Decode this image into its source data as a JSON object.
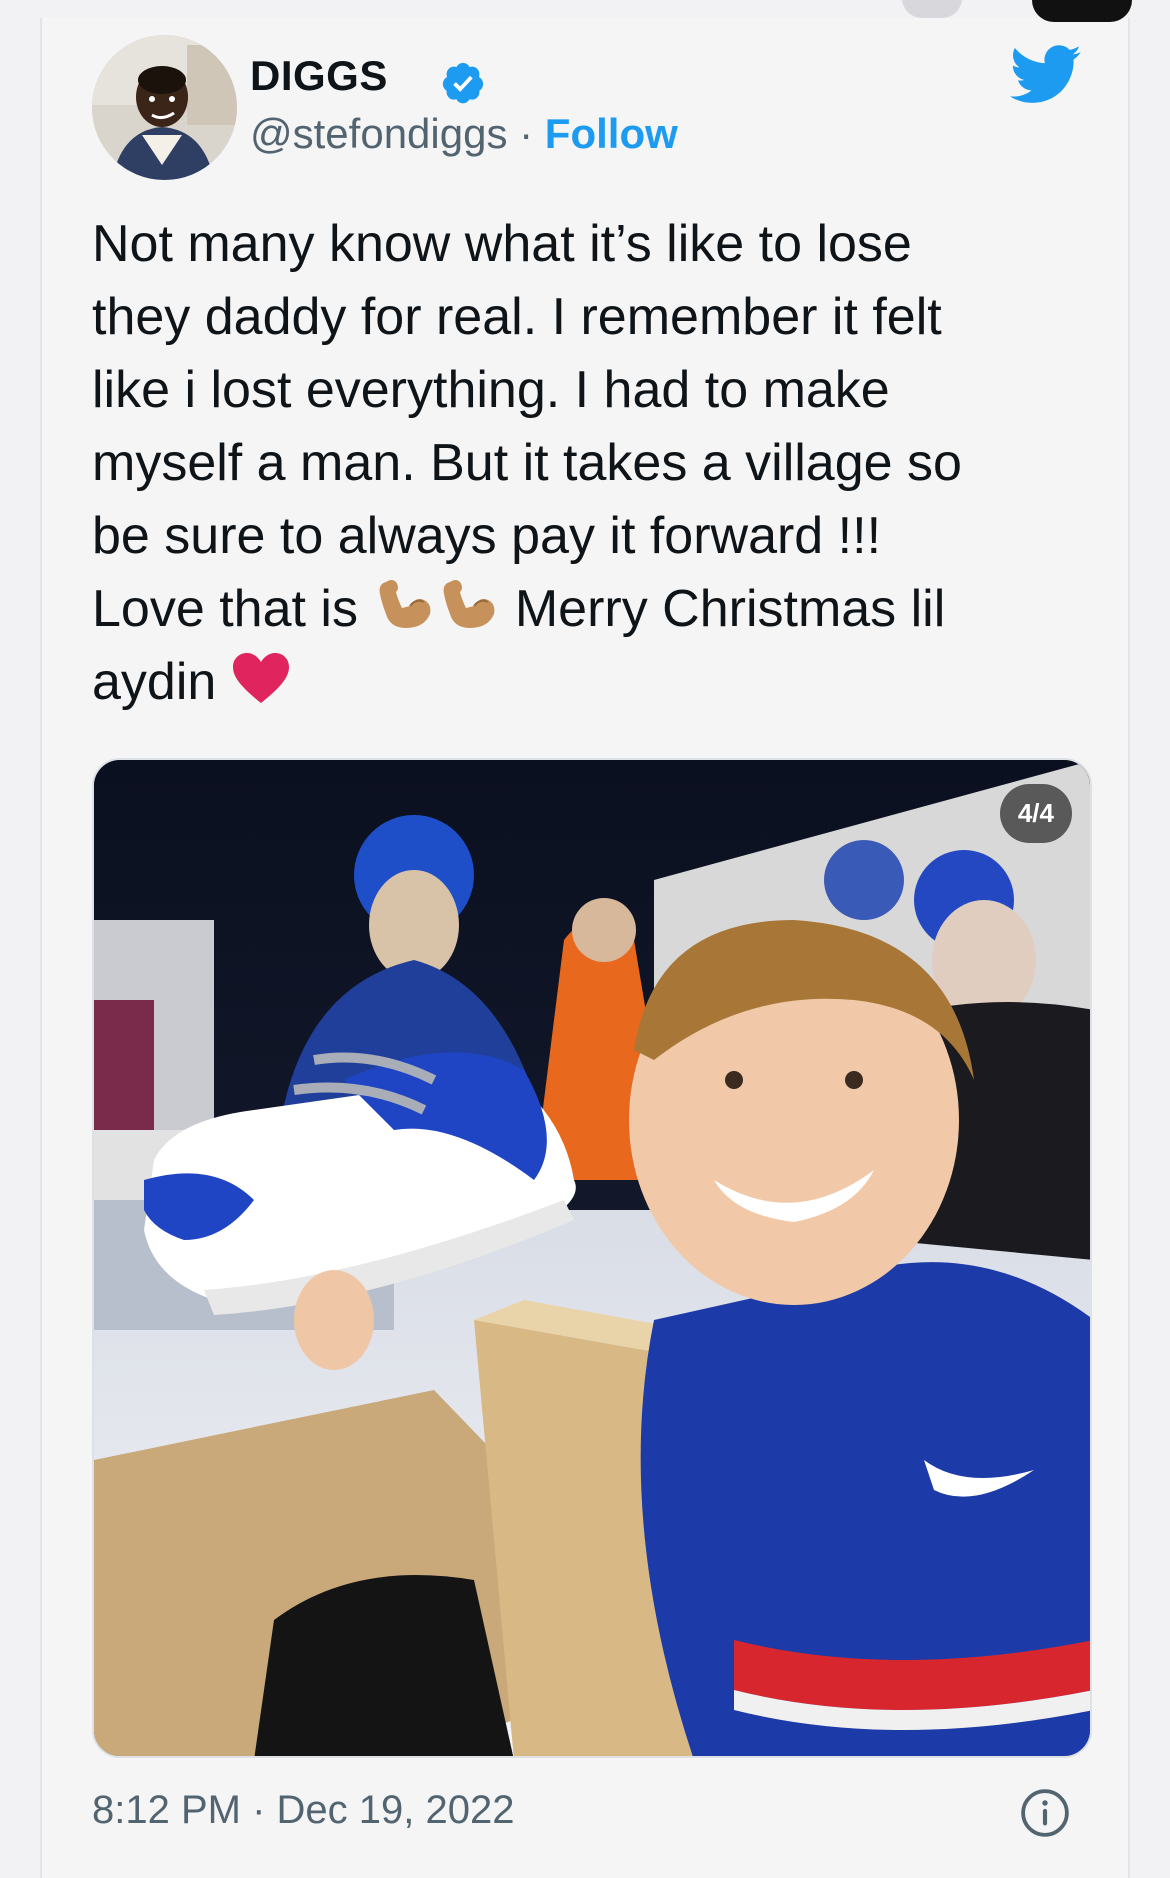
{
  "tweet": {
    "author_name": "DIGGS",
    "handle": "@stefondiggs",
    "separator": " · ",
    "follow_label": "Follow",
    "text_lines": {
      "l1": "Not many know what it’s like to lose",
      "l2": "they daddy for real. I remember it felt",
      "l3": "like i lost everything. I had to make",
      "l4": "myself a man. But it takes a village so",
      "l5": "be sure to always pay it forward !!!",
      "l6_before": "Love that is ",
      "l6_after": " Merry Christmas lil",
      "l7": "aydin "
    },
    "emojis": [
      "flexed-biceps",
      "flexed-biceps",
      "red-heart"
    ],
    "media_counter": "4/4",
    "timestamp": "8:12 PM · Dec 19, 2022"
  },
  "icons": {
    "verified": "verified-badge-icon",
    "brand": "twitter-bird-icon",
    "info": "info-icon"
  },
  "colors": {
    "accent": "#1d9bf0",
    "text_primary": "#0f1419",
    "text_secondary": "#536471",
    "heart": "#e0245e",
    "emoji_skin": "#c7915c"
  }
}
